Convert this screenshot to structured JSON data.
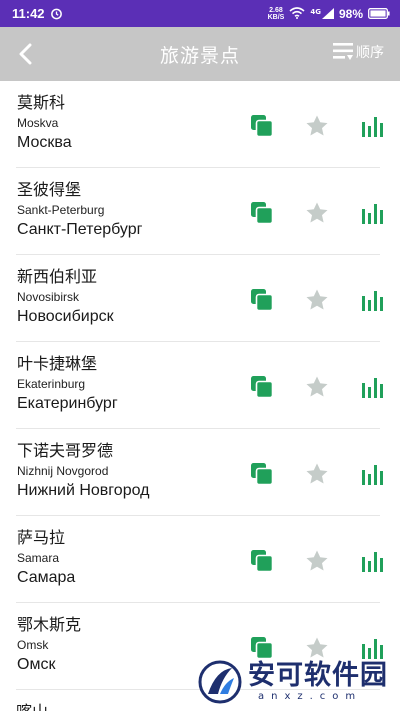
{
  "status_bar": {
    "time": "11:42",
    "speed_value": "2.68",
    "speed_unit": "KB/S",
    "network": "4G",
    "battery": "98%"
  },
  "app_bar": {
    "title": "旅游景点",
    "sort_label": "顺序"
  },
  "cities": [
    {
      "cn": "莫斯科",
      "latin": "Moskva",
      "ru": "Москва"
    },
    {
      "cn": "圣彼得堡",
      "latin": "Sankt-Peterburg",
      "ru": "Санкт-Петербург"
    },
    {
      "cn": "新西伯利亚",
      "latin": "Novosibirsk",
      "ru": "Новосибирск"
    },
    {
      "cn": "叶卡捷琳堡",
      "latin": "Ekaterinburg",
      "ru": "Екатеринбург"
    },
    {
      "cn": "下诺夫哥罗德",
      "latin": "Nizhnij Novgorod",
      "ru": "Нижний Новгород"
    },
    {
      "cn": "萨马拉",
      "latin": "Samara",
      "ru": "Самара"
    },
    {
      "cn": "鄂木斯克",
      "latin": "Omsk",
      "ru": "Омск"
    },
    {
      "cn": "喀山"
    }
  ],
  "watermark": {
    "cn": "安可软件园",
    "en": "anxz.com"
  },
  "colors": {
    "status_bar": "#5b2fb6",
    "app_bar": "#c6c6c6",
    "accent_green": "#20a05a",
    "star_gray": "#c5ccc9"
  },
  "icons": {
    "back": "back-arrow-icon",
    "sort": "sort-list-icon",
    "copy": "copy-icon",
    "favorite": "star-icon",
    "stats": "bar-chart-icon"
  }
}
